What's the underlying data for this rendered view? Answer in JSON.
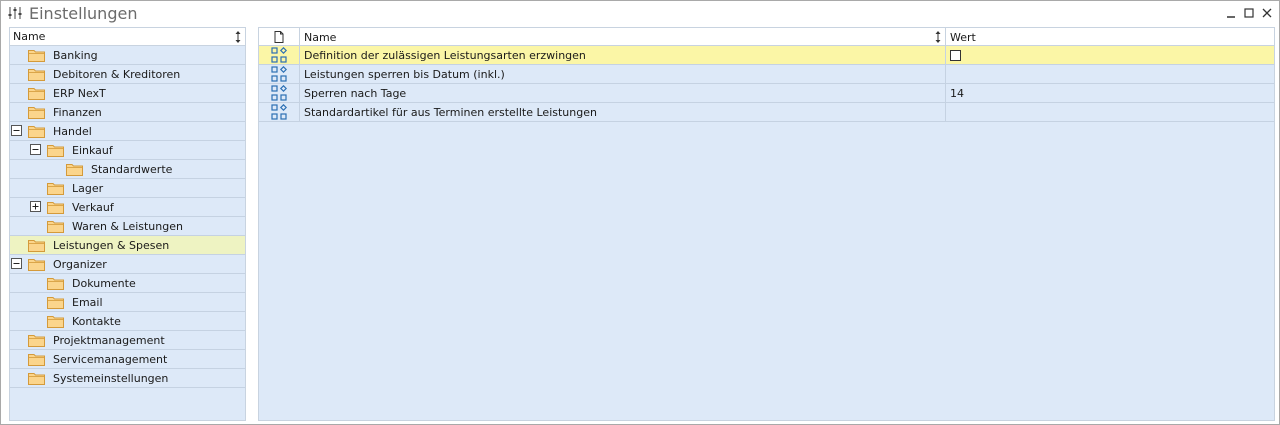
{
  "window": {
    "title": "Einstellungen",
    "controls": [
      "minimize-icon",
      "maximize-icon",
      "close-icon"
    ]
  },
  "tree": {
    "header": "Name",
    "items": [
      {
        "label": "Banking",
        "level": 0,
        "expander": "none",
        "selected": false
      },
      {
        "label": "Debitoren & Kreditoren",
        "level": 0,
        "expander": "none",
        "selected": false
      },
      {
        "label": "ERP NexT",
        "level": 0,
        "expander": "none",
        "selected": false
      },
      {
        "label": "Finanzen",
        "level": 0,
        "expander": "none",
        "selected": false
      },
      {
        "label": "Handel",
        "level": 0,
        "expander": "minus",
        "selected": false
      },
      {
        "label": "Einkauf",
        "level": 1,
        "expander": "minus",
        "selected": false
      },
      {
        "label": "Standardwerte",
        "level": 2,
        "expander": "none",
        "selected": false
      },
      {
        "label": "Lager",
        "level": 1,
        "expander": "none",
        "selected": false
      },
      {
        "label": "Verkauf",
        "level": 1,
        "expander": "plus",
        "selected": false
      },
      {
        "label": "Waren & Leistungen",
        "level": 1,
        "expander": "none",
        "selected": false
      },
      {
        "label": "Leistungen & Spesen",
        "level": 0,
        "expander": "none",
        "selected": true
      },
      {
        "label": "Organizer",
        "level": 0,
        "expander": "minus",
        "selected": false
      },
      {
        "label": "Dokumente",
        "level": 1,
        "expander": "none",
        "selected": false
      },
      {
        "label": "Email",
        "level": 1,
        "expander": "none",
        "selected": false
      },
      {
        "label": "Kontakte",
        "level": 1,
        "expander": "none",
        "selected": false
      },
      {
        "label": "Projektmanagement",
        "level": 0,
        "expander": "none",
        "selected": false
      },
      {
        "label": "Servicemanagement",
        "level": 0,
        "expander": "none",
        "selected": false
      },
      {
        "label": "Systemeinstellungen",
        "level": 0,
        "expander": "none",
        "selected": false
      }
    ]
  },
  "grid": {
    "columns": {
      "name": "Name",
      "value": "Wert"
    },
    "rows": [
      {
        "name": "Definition der zulässigen Leistungsarten erzwingen",
        "value": "",
        "type": "checkbox",
        "checked": false,
        "highlight": true
      },
      {
        "name": "Leistungen sperren bis Datum (inkl.)",
        "value": "",
        "type": "text",
        "highlight": false
      },
      {
        "name": "Sperren nach Tage",
        "value": "14",
        "type": "text",
        "highlight": false
      },
      {
        "name": "Standardartikel für aus Terminen erstellte Leistungen",
        "value": "",
        "type": "text",
        "highlight": false
      }
    ]
  },
  "colors": {
    "panel_bg": "#dde9f8",
    "selected_tree_row": "#eef3c2",
    "highlight_grid_row": "#fbf6a6",
    "folder_fill": "#fbd58c",
    "folder_stroke": "#d49a3a",
    "row_icon": "#2b6fb3"
  }
}
